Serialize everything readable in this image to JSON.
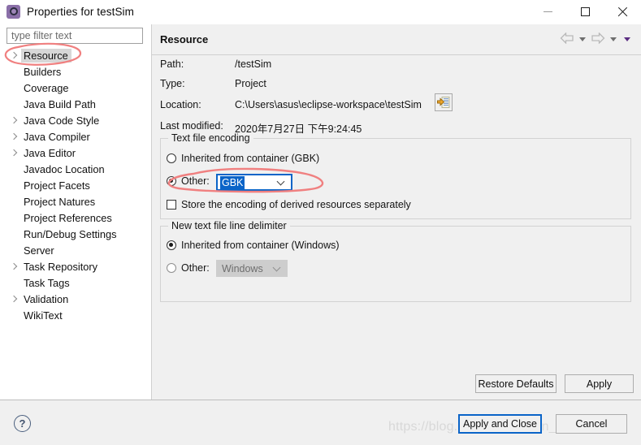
{
  "window": {
    "title": "Properties for testSim",
    "icon": "properties-gear-icon",
    "minimize_label": "Minimize",
    "maximize_label": "Maximize",
    "close_label": "Close"
  },
  "filter": {
    "placeholder": "type filter text",
    "value": ""
  },
  "tree": {
    "items": [
      {
        "label": "Resource",
        "expandable": true,
        "selected": true
      },
      {
        "label": "Builders",
        "expandable": false,
        "selected": false
      },
      {
        "label": "Coverage",
        "expandable": false,
        "selected": false
      },
      {
        "label": "Java Build Path",
        "expandable": false,
        "selected": false
      },
      {
        "label": "Java Code Style",
        "expandable": true,
        "selected": false
      },
      {
        "label": "Java Compiler",
        "expandable": true,
        "selected": false
      },
      {
        "label": "Java Editor",
        "expandable": true,
        "selected": false
      },
      {
        "label": "Javadoc Location",
        "expandable": false,
        "selected": false
      },
      {
        "label": "Project Facets",
        "expandable": false,
        "selected": false
      },
      {
        "label": "Project Natures",
        "expandable": false,
        "selected": false
      },
      {
        "label": "Project References",
        "expandable": false,
        "selected": false
      },
      {
        "label": "Run/Debug Settings",
        "expandable": false,
        "selected": false
      },
      {
        "label": "Server",
        "expandable": false,
        "selected": false
      },
      {
        "label": "Task Repository",
        "expandable": true,
        "selected": false
      },
      {
        "label": "Task Tags",
        "expandable": false,
        "selected": false
      },
      {
        "label": "Validation",
        "expandable": true,
        "selected": false
      },
      {
        "label": "WikiText",
        "expandable": false,
        "selected": false
      }
    ]
  },
  "page": {
    "title": "Resource",
    "nav": {
      "back_icon": "back-arrow-icon",
      "back_menu_icon": "chevron-down-icon",
      "forward_icon": "forward-arrow-icon",
      "forward_menu_icon": "chevron-down-icon",
      "view_menu_icon": "view-menu-chevron-icon"
    },
    "fields": [
      {
        "label": "Path:",
        "value": "/testSim"
      },
      {
        "label": "Type:",
        "value": "Project"
      },
      {
        "label": "Location:",
        "value": "C:\\Users\\asus\\eclipse-workspace\\testSim"
      },
      {
        "label": "Last modified:",
        "value": "2020年7月27日 下午9:24:45"
      }
    ],
    "location_button_icon": "open-in-explorer-icon",
    "encoding_group": {
      "title": "Text file encoding",
      "inherited_label": "Inherited from container (GBK)",
      "inherited_selected": false,
      "other_label": "Other:",
      "other_selected": true,
      "other_value": "GBK",
      "store_derived_label": "Store the encoding of derived resources separately",
      "store_derived_checked": false
    },
    "delimiter_group": {
      "title": "New text file line delimiter",
      "inherited_label": "Inherited from container (Windows)",
      "inherited_selected": true,
      "other_label": "Other:",
      "other_selected": false,
      "other_value": "Windows",
      "other_disabled": true
    }
  },
  "buttons": {
    "restore_defaults": "Restore Defaults",
    "apply": "Apply",
    "apply_and_close": "Apply and Close",
    "cancel": "Cancel",
    "help_icon": "help-question-icon"
  },
  "annotations": {
    "color": "#f08080",
    "resource_circle": "red ellipse around Resource tree item",
    "encoding_circle": "red ellipse around Other GBK combo"
  },
  "watermark": {
    "text": "https://blog.csdn.net/weixin_43824233"
  }
}
